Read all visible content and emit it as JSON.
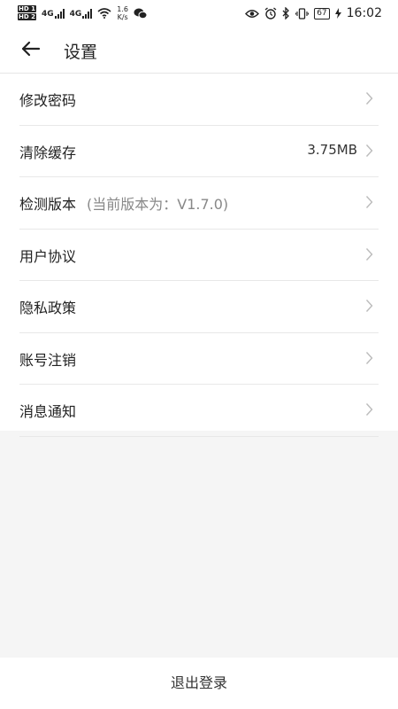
{
  "status_bar": {
    "network_top": "HD 1",
    "network_bottom": "HD 2",
    "signal1_type": "4G",
    "signal2_type": "4G",
    "speed_value": "1.6",
    "speed_unit": "K/s",
    "battery": "67",
    "time": "16:02"
  },
  "header": {
    "title": "设置"
  },
  "settings": {
    "items": [
      {
        "label": "修改密码"
      },
      {
        "label": "清除缓存",
        "value": "3.75MB"
      },
      {
        "label": "检测版本",
        "sub": "(当前版本为：V1.7.0)"
      },
      {
        "label": "用户协议"
      },
      {
        "label": "隐私政策"
      },
      {
        "label": "账号注销"
      },
      {
        "label": "消息通知"
      }
    ]
  },
  "footer": {
    "logout_label": "退出登录"
  },
  "icons": [
    "back-arrow-icon",
    "chevron-right-icon",
    "wifi-icon",
    "wechat-icon",
    "eye-icon",
    "alarm-icon",
    "bluetooth-icon",
    "vibrate-icon",
    "charging-icon"
  ]
}
